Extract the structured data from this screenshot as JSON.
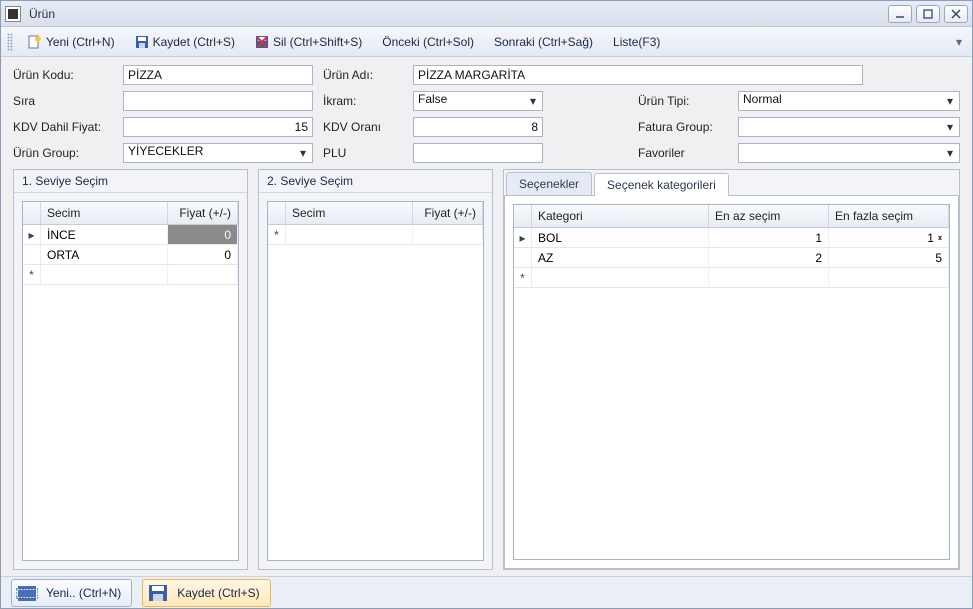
{
  "window": {
    "title": "Ürün"
  },
  "toolbar": {
    "new": "Yeni (Ctrl+N)",
    "save": "Kaydet (Ctrl+S)",
    "delete": "Sil (Ctrl+Shift+S)",
    "prev": "Önceki (Ctrl+Sol)",
    "next": "Sonraki (Ctrl+Sağ)",
    "list": "Liste(F3)"
  },
  "form": {
    "urun_kodu_lbl": "Ürün Kodu:",
    "urun_kodu": "PİZZA",
    "urun_adi_lbl": "Ürün Adı:",
    "urun_adi": "PİZZA MARGARİTA",
    "sira_lbl": "Sıra",
    "sira": "",
    "ikram_lbl": "İkram:",
    "ikram": "False",
    "urun_tipi_lbl": "Ürün Tipi:",
    "urun_tipi": "Normal",
    "kdv_dahil_fiyat_lbl": "KDV Dahil Fiyat:",
    "kdv_dahil_fiyat": "15",
    "kdv_orani_lbl": "KDV Oranı",
    "kdv_orani": "8",
    "fatura_group_lbl": "Fatura Group:",
    "fatura_group": "",
    "urun_group_lbl": "Ürün Group:",
    "urun_group": "YİYECEKLER",
    "plu_lbl": "PLU",
    "plu": "",
    "favoriler_lbl": "Favoriler",
    "favoriler": ""
  },
  "panel1": {
    "title": "1. Seviye Seçim",
    "col_secim": "Secim",
    "col_fiyat": "Fiyat (+/-)",
    "rows": [
      {
        "secim": "İNCE",
        "fiyat": "0"
      },
      {
        "secim": "ORTA",
        "fiyat": "0"
      }
    ]
  },
  "panel2": {
    "title": "2. Seviye Seçim",
    "col_secim": "Secim",
    "col_fiyat": "Fiyat (+/-)"
  },
  "tabs": {
    "secenekler": "Seçenekler",
    "secenek_kategorileri": "Seçenek kategorileri"
  },
  "kategori": {
    "col_kategori": "Kategori",
    "col_enaz": "En az seçim",
    "col_enfazla": "En fazla seçim",
    "rows": [
      {
        "kategori": "BOL",
        "enaz": "1",
        "enfazla": "1"
      },
      {
        "kategori": "AZ",
        "enaz": "2",
        "enfazla": "5"
      }
    ]
  },
  "footer": {
    "new": "Yeni.. (Ctrl+N)",
    "save": "Kaydet (Ctrl+S)"
  }
}
